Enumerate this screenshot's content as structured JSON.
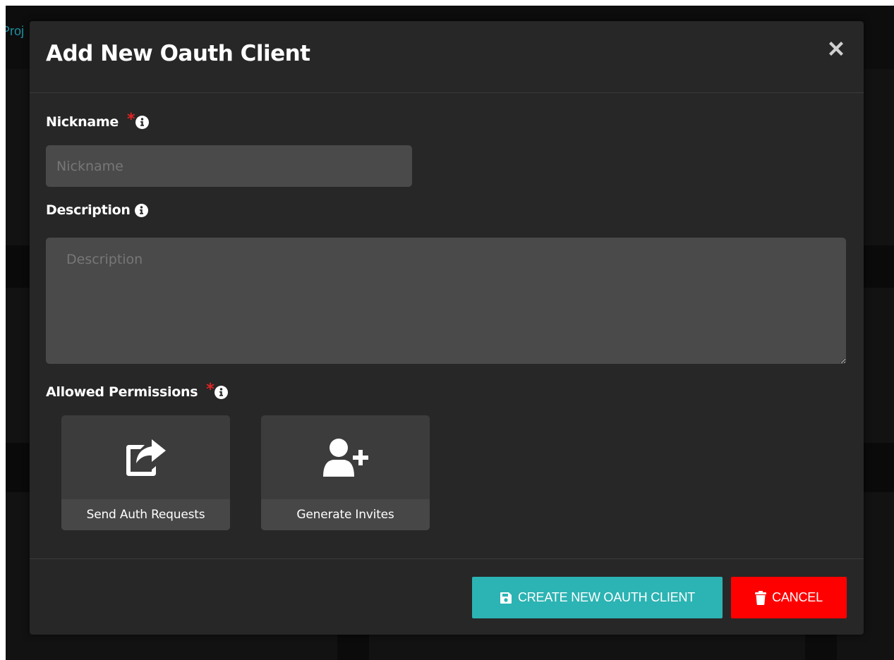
{
  "background": {
    "nav_text": "Proj"
  },
  "modal": {
    "title": "Add New Oauth Client",
    "close_icon": "close-icon"
  },
  "fields": {
    "nickname": {
      "label": "Nickname",
      "required_mark": "*",
      "placeholder": "Nickname",
      "value": ""
    },
    "description": {
      "label": "Description",
      "placeholder": "Description",
      "value": ""
    },
    "permissions": {
      "label": "Allowed Permissions",
      "required_mark": "*",
      "options": [
        {
          "label": "Send Auth Requests",
          "icon": "share-icon"
        },
        {
          "label": "Generate Invites",
          "icon": "user-plus-icon"
        }
      ]
    }
  },
  "footer": {
    "create_label": "CREATE NEW OAUTH CLIENT",
    "create_icon": "save-icon",
    "cancel_label": "CANCEL",
    "cancel_icon": "trash-icon"
  },
  "colors": {
    "accent": "#2cb3b3",
    "danger": "#ff0000",
    "required": "#e02424",
    "modal_bg": "#272727"
  }
}
